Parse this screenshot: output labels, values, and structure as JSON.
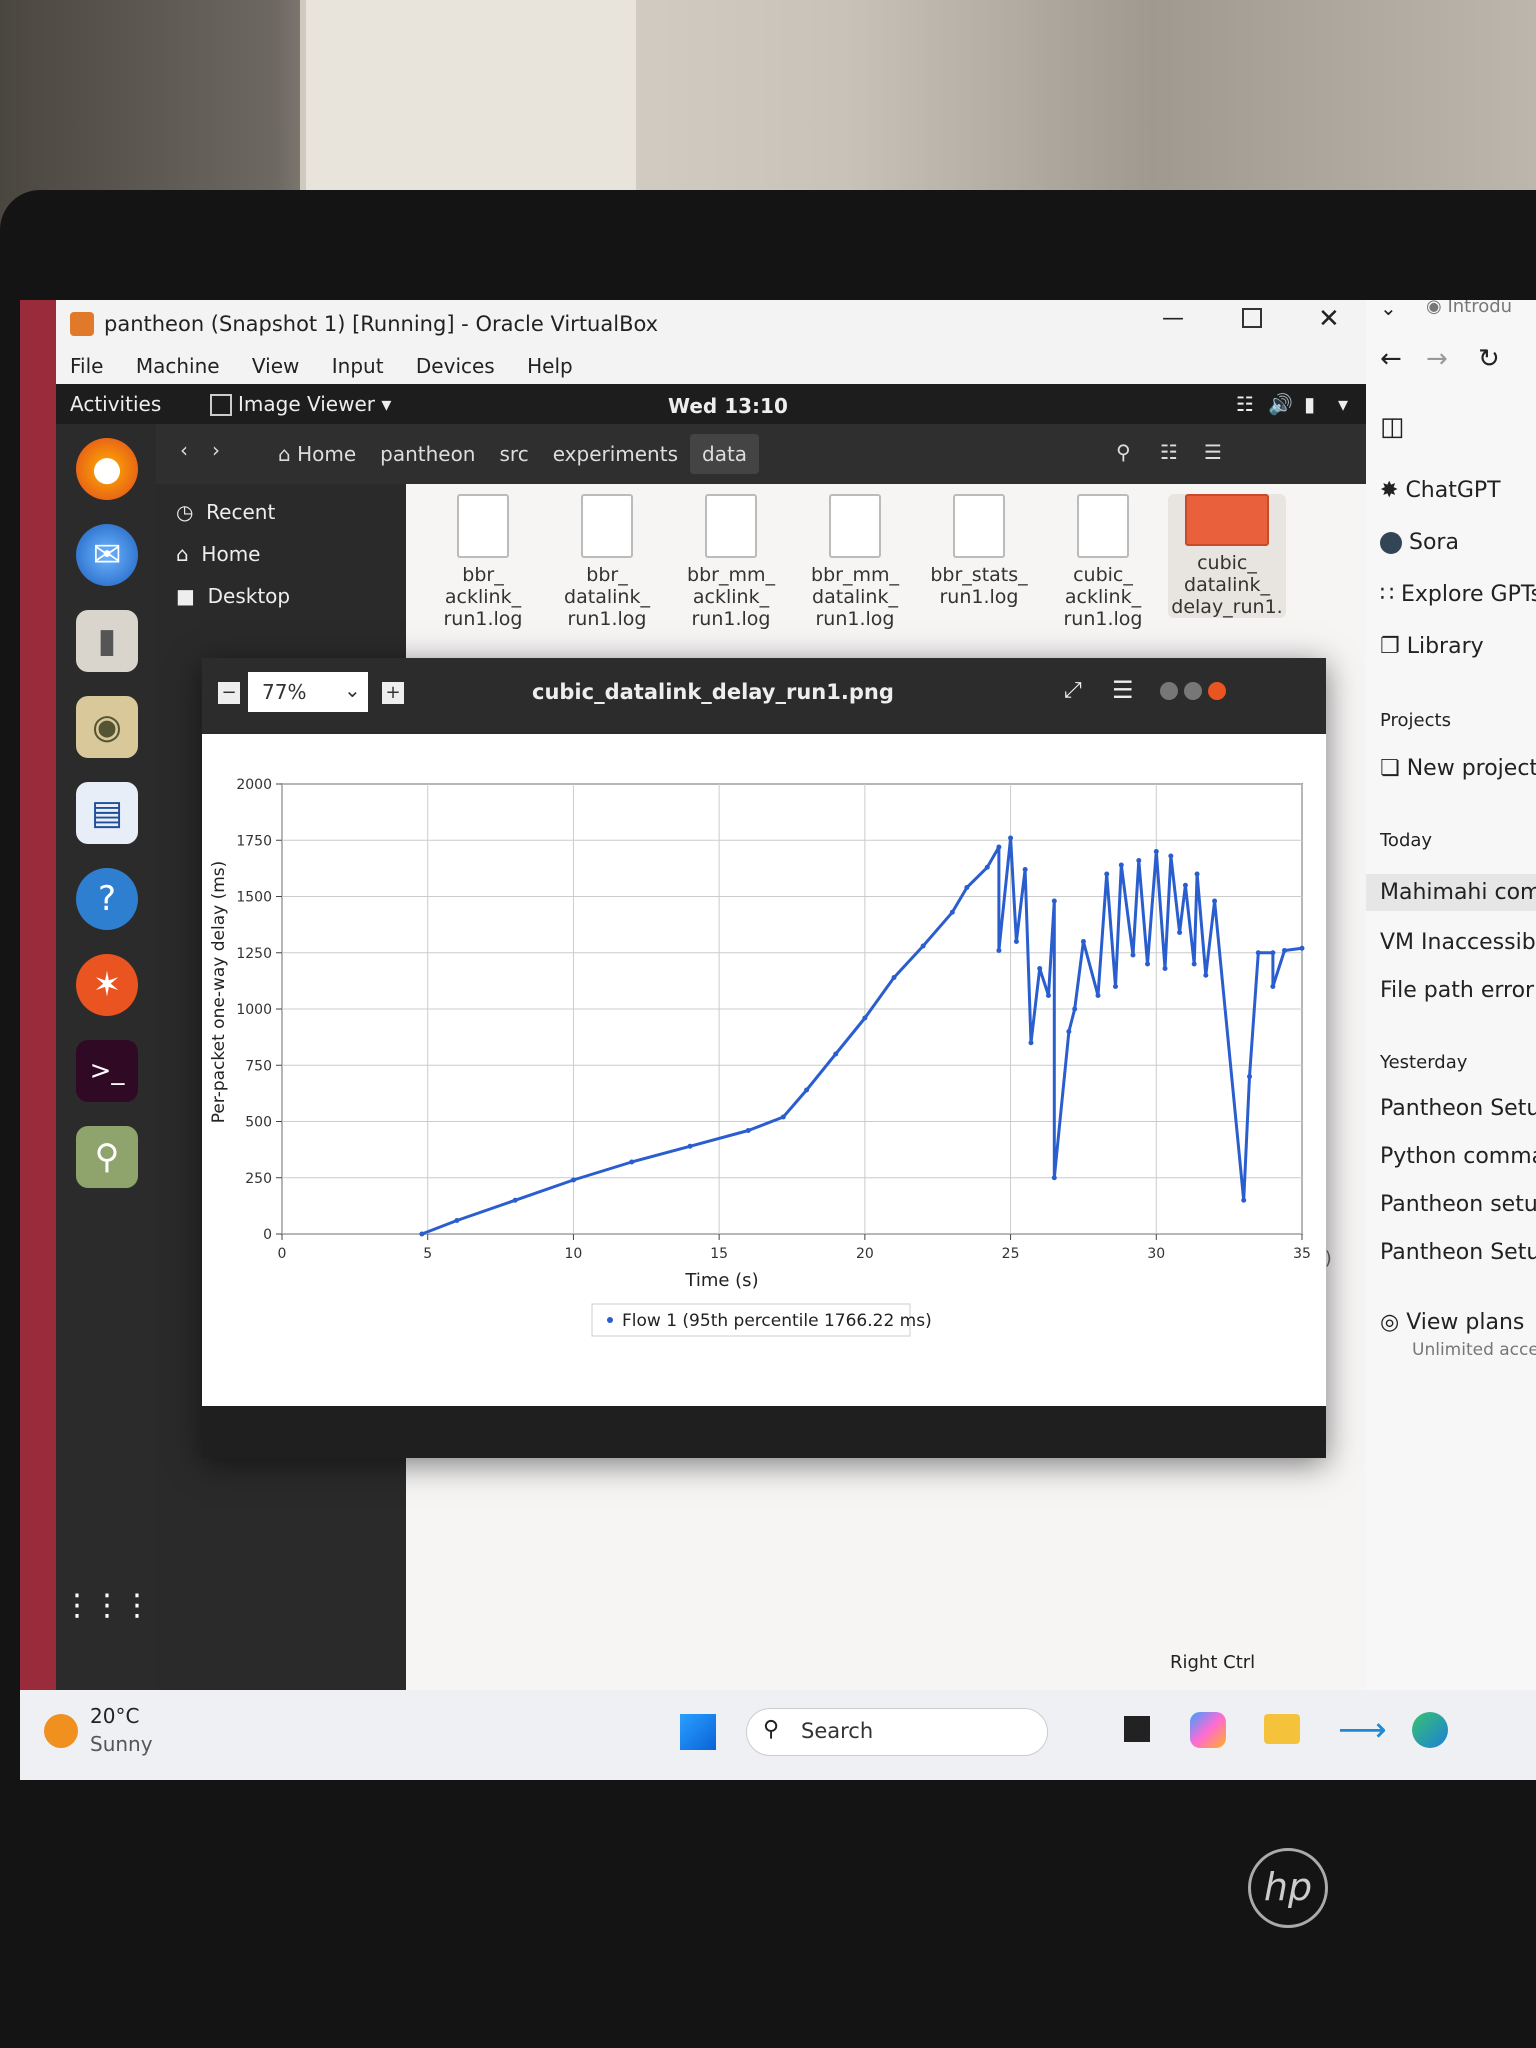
{
  "vbox": {
    "title": "pantheon (Snapshot 1) [Running] - Oracle VirtualBox",
    "menu": [
      "File",
      "Machine",
      "View",
      "Input",
      "Devices",
      "Help"
    ],
    "host_key": "Right Ctrl"
  },
  "gnome": {
    "activities": "Activities",
    "app_menu": "Image Viewer",
    "clock": "Wed 13:10"
  },
  "files": {
    "breadcrumb": [
      "Home",
      "pantheon",
      "src",
      "experiments",
      "data"
    ],
    "sidebar": [
      "Recent",
      "Home",
      "Desktop"
    ],
    "items": [
      {
        "name": "bbr_ acklink_ run1.log"
      },
      {
        "name": "bbr_ datalink_ run1.log"
      },
      {
        "name": "bbr_mm_ acklink_ run1.log"
      },
      {
        "name": "bbr_mm_ datalink_ run1.log"
      },
      {
        "name": "bbr_stats_ run1.log"
      },
      {
        "name": "cubic_ acklink_ run1.log"
      },
      {
        "name": "cubic_ datalink_ delay_run1."
      }
    ],
    "status_fragment": "kB)"
  },
  "viewer": {
    "zoom": "77%",
    "filename": "cubic_datalink_delay_run1.png"
  },
  "chart_data": {
    "type": "line",
    "title": "",
    "xlabel": "Time (s)",
    "ylabel": "Per-packet one-way delay (ms)",
    "xlim": [
      0,
      35
    ],
    "ylim": [
      0,
      2000
    ],
    "xticks": [
      0,
      5,
      10,
      15,
      20,
      25,
      30,
      35
    ],
    "yticks": [
      0,
      250,
      500,
      750,
      1000,
      1250,
      1500,
      1750,
      2000
    ],
    "grid": true,
    "legend_position": "bottom",
    "series": [
      {
        "name": "Flow 1 (95th percentile 1766.22 ms)",
        "color": "#2a5ecf",
        "x": [
          4.8,
          6,
          8,
          10,
          12,
          14,
          16,
          17.2,
          18,
          19,
          20,
          21,
          22,
          23,
          23.5,
          24.2,
          24.6,
          24.6,
          25.0,
          25.2,
          25.5,
          25.7,
          26,
          26.3,
          26.5,
          26.5,
          27,
          27.2,
          27.5,
          28,
          28.3,
          28.6,
          28.8,
          29.2,
          29.4,
          29.7,
          30.0,
          30.3,
          30.5,
          30.8,
          31.0,
          31.3,
          31.4,
          31.7,
          32.0,
          33.0,
          33.2,
          33.5,
          34.0,
          34.0,
          34.4,
          35.0
        ],
        "y": [
          0,
          60,
          150,
          240,
          320,
          390,
          460,
          520,
          640,
          800,
          960,
          1140,
          1280,
          1430,
          1540,
          1630,
          1720,
          1260,
          1760,
          1300,
          1620,
          850,
          1180,
          1060,
          1480,
          250,
          900,
          1000,
          1300,
          1060,
          1600,
          1100,
          1640,
          1240,
          1660,
          1200,
          1700,
          1180,
          1680,
          1340,
          1550,
          1200,
          1600,
          1150,
          1480,
          150,
          700,
          1250,
          1250,
          1100,
          1260,
          1270
        ]
      }
    ]
  },
  "browser": {
    "tab": "Introdu",
    "nav": [
      "ChatGPT",
      "Sora",
      "Explore GPTs",
      "Library"
    ],
    "projects_heading": "Projects",
    "new_project": "New project",
    "today_heading": "Today",
    "today": [
      "Mahimahi comma",
      "VM Inaccessible F",
      "File path error fix"
    ],
    "yesterday_heading": "Yesterday",
    "yesterday": [
      "Pantheon Setup Gu",
      "Python command e",
      "Pantheon setup gui",
      "Pantheon Setup and"
    ],
    "view_plans": "View plans",
    "view_plans_sub": "Unlimited access,"
  },
  "taskbar": {
    "weather_temp": "20°C",
    "weather_desc": "Sunny",
    "search_placeholder": "Search"
  },
  "brand": "hp"
}
